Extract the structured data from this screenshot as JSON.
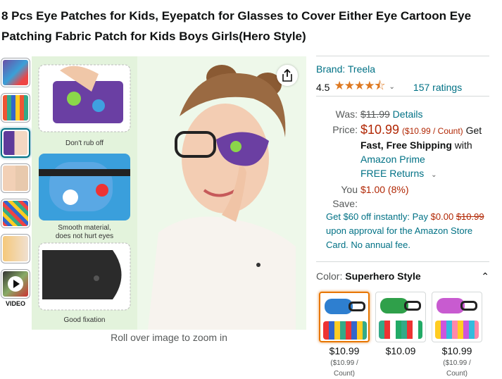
{
  "product": {
    "title": "8 Pcs Eye Patches for Kids, Eyepatch for Glasses to Cover Either Eye Cartoon Eye Patching Fabric Patch for Kids Boys Girls(Hero Style)"
  },
  "gallery": {
    "video_label": "VIDEO",
    "zoom_hint": "Roll over image to zoom in",
    "captions": [
      "Don't rub off",
      "Smooth material,\ndoes not hurt eyes",
      "Good fixation"
    ],
    "icons": [
      "share-icon",
      "play-icon"
    ]
  },
  "buybox": {
    "brand": "Brand: Treela",
    "rating_value": "4.5",
    "stars": "★★★★⯪",
    "ratings_count": "157 ratings",
    "was_label": "Was:",
    "was_price": "$11.99",
    "details_link": "Details",
    "price_label": "Price:",
    "price": "$10.99",
    "price_unit": "($10.99 / Count)",
    "get_text": "Get",
    "shipping": "Fast, Free Shipping",
    "with_text": "with",
    "prime_link": "Amazon Prime",
    "returns_link": "FREE Returns",
    "you_save_label": "You Save:",
    "you_save": "$1.00 (8%)",
    "card_offer_1": "Get $60 off instantly: Pay",
    "card_offer_pay": "$0.00",
    "card_offer_strike": "$10.99",
    "card_offer_2": "upon approval for the Amazon Store Card. No annual fee."
  },
  "color": {
    "label": "Color:",
    "value": "Superhero Style",
    "swatches": [
      {
        "price": "$10.99",
        "unit": "($10.99 / Count)"
      },
      {
        "price": "$10.09",
        "unit": ""
      },
      {
        "price": "$10.99",
        "unit": "($10.99 / Count)"
      }
    ]
  },
  "colors": {
    "link": "#007185",
    "price_red": "#B12704",
    "star": "#de7921",
    "selected_swatch": "#e77600"
  }
}
